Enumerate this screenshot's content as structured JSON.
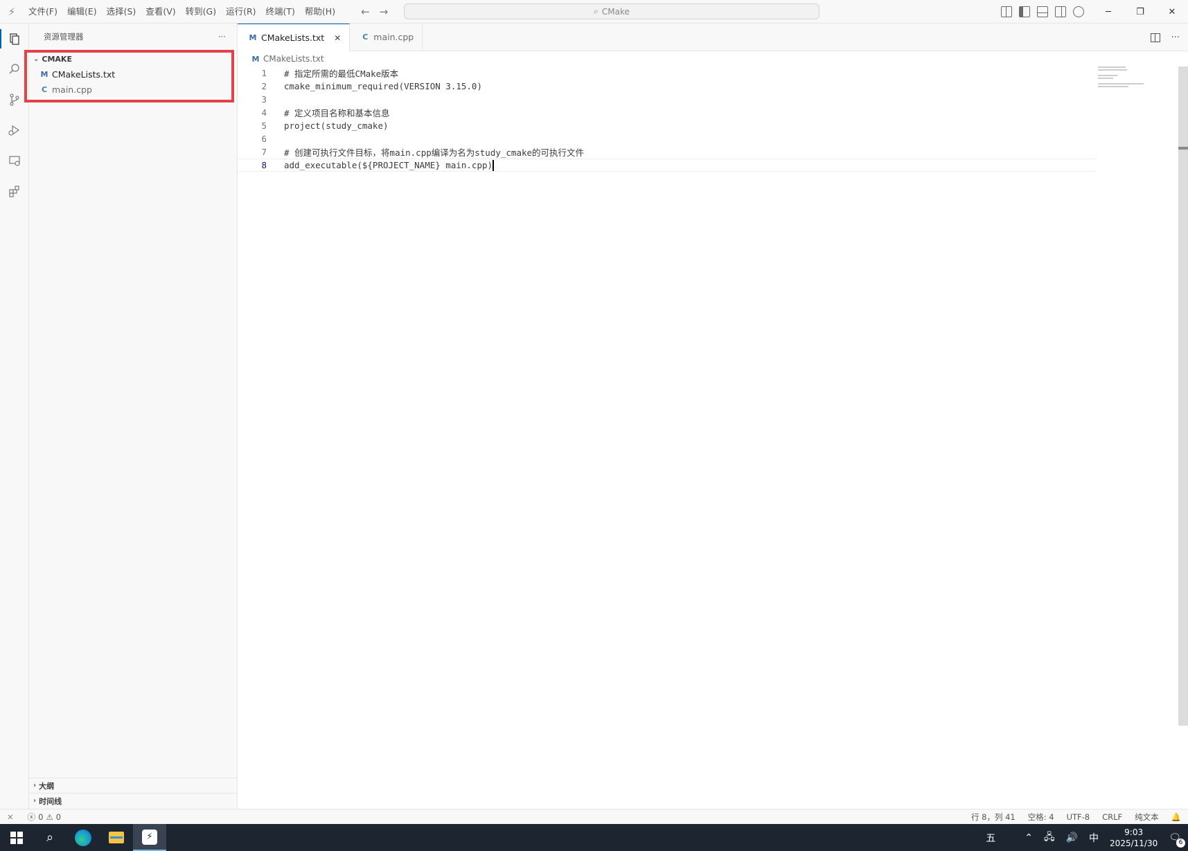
{
  "titlebar": {
    "menu": [
      "文件(F)",
      "编辑(E)",
      "选择(S)",
      "查看(V)",
      "转到(G)",
      "运行(R)",
      "终端(T)",
      "帮助(H)"
    ],
    "search_text": "CMake",
    "icons": [
      "vscode-logo-icon",
      "back-arrow-icon",
      "forward-arrow-icon",
      "search-icon",
      "customize-layout-icon",
      "toggle-primary-sidebar-icon",
      "toggle-panel-icon",
      "toggle-secondary-sidebar-icon",
      "account-icon",
      "minimize-icon",
      "restore-icon",
      "close-icon"
    ]
  },
  "activitybar": {
    "items": [
      "explorer-icon",
      "search-icon",
      "source-control-icon",
      "run-debug-icon",
      "remote-explorer-icon",
      "extensions-icon"
    ]
  },
  "sidebar": {
    "title": "资源管理器",
    "more": "···",
    "folder": "CMAKE",
    "files": [
      {
        "name": "CMakeLists.txt",
        "icon": "M"
      },
      {
        "name": "main.cpp",
        "icon": "C"
      }
    ],
    "outline": "大纲",
    "timeline": "时间线",
    "highlight_color": "#e2424a"
  },
  "editor": {
    "tabs": [
      {
        "label": "CMakeLists.txt",
        "icon": "M",
        "close": "✕"
      },
      {
        "label": "main.cpp",
        "icon": "C"
      }
    ],
    "breadcrumb": "CMakeLists.txt",
    "lines": [
      {
        "num": "1",
        "text": "# 指定所需的最低CMake版本"
      },
      {
        "num": "2",
        "text": "cmake_minimum_required(VERSION 3.15.0)"
      },
      {
        "num": "3",
        "text": ""
      },
      {
        "num": "4",
        "text": "# 定义项目名称和基本信息"
      },
      {
        "num": "5",
        "text": "project(study_cmake)"
      },
      {
        "num": "6",
        "text": ""
      },
      {
        "num": "7",
        "text": "# 创建可执行文件目标，将main.cpp编译为名为study_cmake的可执行文件"
      },
      {
        "num": "8",
        "text": "add_executable(${PROJECT_NAME} main.cpp)"
      }
    ]
  },
  "statusbar": {
    "errors": "0",
    "warnings": "0",
    "position": "行 8，列 41",
    "spaces": "空格: 4",
    "encoding": "UTF-8",
    "eol": "CRLF",
    "language": "纯文本"
  },
  "taskbar": {
    "time": "9:03",
    "date": "2025/11/30",
    "ime": "中",
    "notifications": "6",
    "ime_mode": "五"
  }
}
